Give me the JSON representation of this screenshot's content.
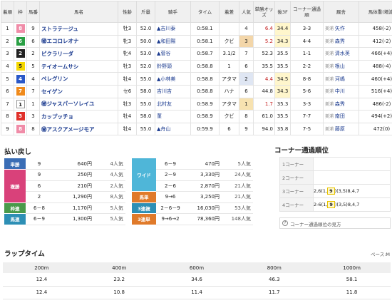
{
  "results": {
    "headers": [
      "着順",
      "枠",
      "馬番",
      "馬名",
      "性齢",
      "斤量",
      "騎手",
      "タイム",
      "着差",
      "人気",
      "単勝オッズ",
      "後3F",
      "コーナー通過順",
      "厩舎",
      "馬体重(増減)"
    ],
    "rows": [
      {
        "pos": "1",
        "waku": "8",
        "num": "9",
        "name": "ストラテージュ",
        "sex": "牡3",
        "wt": "52.0",
        "jockey": "▲吉川泰",
        "time": "0:58.1",
        "margin": "",
        "pop": "4",
        "odds": "6.4",
        "f3": "34.4",
        "corner": "3-3",
        "stable": "美浦 矢作",
        "bw": "458(-2)"
      },
      {
        "pos": "2",
        "waku": "6",
        "num": "6",
        "name": "㊙エコロレオナ",
        "sex": "牝3",
        "wt": "50.0",
        "jockey": "▲和田陽",
        "time": "0:58.1",
        "margin": "クビ",
        "pop": "3",
        "odds": "5.2",
        "f3": "34.3",
        "corner": "4-4",
        "stable": "美浦 森秀",
        "bw": "412(-2)"
      },
      {
        "pos": "3",
        "waku": "2",
        "num": "2",
        "name": "ピクラリーダ",
        "sex": "牝4",
        "wt": "53.0",
        "jockey": "▲菅谷",
        "time": "0:58.7",
        "margin": "3.1/2",
        "pop": "7",
        "odds": "52.3",
        "f3": "35.5",
        "corner": "1-1",
        "stable": "美浦 清水英",
        "bw": "466(+4)"
      },
      {
        "pos": "4",
        "waku": "5",
        "num": "5",
        "name": "テイオームサシ",
        "sex": "牡3",
        "wt": "52.0",
        "jockey": "鈴野頭",
        "time": "0:58.8",
        "margin": "1",
        "pop": "6",
        "odds": "35.5",
        "f3": "35.5",
        "corner": "2-2",
        "stable": "美浦 根山",
        "bw": "488(-4)"
      },
      {
        "pos": "5",
        "waku": "4",
        "num": "4",
        "name": "ペレグリン",
        "sex": "牡4",
        "wt": "55.0",
        "jockey": "▲小林美",
        "time": "0:58.8",
        "margin": "アタマ",
        "pop": "2",
        "odds": "4.4",
        "f3": "34.5",
        "corner": "8-8",
        "stable": "美浦 河嶋",
        "bw": "460(+4)"
      },
      {
        "pos": "6",
        "waku": "7",
        "num": "7",
        "name": "セイゲン",
        "sex": "セ6",
        "wt": "58.0",
        "jockey": "吉川吉",
        "time": "0:58.8",
        "margin": "ハナ",
        "pop": "6",
        "odds": "44.8",
        "f3": "34.3",
        "corner": "5-6",
        "stable": "美浦 中川",
        "bw": "516(+4)"
      },
      {
        "pos": "7",
        "waku": "1",
        "num": "1",
        "name": "㊙ジャスパーソレイユ",
        "sex": "牡3",
        "wt": "55.0",
        "jockey": "北村友",
        "time": "0:58.9",
        "margin": "アタマ",
        "pop": "1",
        "odds": "1.7",
        "f3": "35.3",
        "corner": "3-3",
        "stable": "美浦 森秀",
        "bw": "486(-2)"
      },
      {
        "pos": "8",
        "waku": "3",
        "num": "3",
        "name": "カップッチョ",
        "sex": "牡4",
        "wt": "58.0",
        "jockey": "菫",
        "time": "0:58.9",
        "margin": "クビ",
        "pop": "8",
        "odds": "61.0",
        "f3": "35.5",
        "corner": "7-7",
        "stable": "美浦 南田",
        "bw": "494(+2)"
      },
      {
        "pos": "9",
        "waku": "8",
        "num": "8",
        "name": "㊙アスクアメージモア",
        "sex": "牡4",
        "wt": "55.0",
        "jockey": "▲舟山",
        "time": "0:59.9",
        "margin": "6",
        "pop": "9",
        "odds": "94.0",
        "f3": "35.8",
        "corner": "7-5",
        "stable": "美浦 藤原",
        "bw": "472(0)"
      }
    ]
  },
  "payout": {
    "title": "払い戻し",
    "left": [
      {
        "label": "単勝",
        "num": "9",
        "amt": "640円",
        "pop": "4人気",
        "color": "#3a6db5",
        "span": 1
      },
      {
        "label": "複勝",
        "num": "9",
        "amt": "250円",
        "pop": "4人気",
        "color": "#d9417a",
        "span": 3
      },
      {
        "label": "",
        "num": "6",
        "amt": "210円",
        "pop": "2人気",
        "color": "",
        "span": 0
      },
      {
        "label": "",
        "num": "2",
        "amt": "1,290円",
        "pop": "8人気",
        "color": "",
        "span": 0
      },
      {
        "label": "枠連",
        "num": "6－8",
        "amt": "1,170円",
        "pop": "5人気",
        "color": "#4a9a4a",
        "span": 1
      },
      {
        "label": "馬連",
        "num": "6－9",
        "amt": "1,300円",
        "pop": "5人気",
        "color": "#2d8fb5",
        "span": 1
      }
    ],
    "right": [
      {
        "label": "ワイド",
        "num": "6－9",
        "amt": "470円",
        "pop": "5人気",
        "color": "#4fb6d8",
        "span": 3
      },
      {
        "label": "",
        "num": "2－9",
        "amt": "3,330円",
        "pop": "24人気",
        "color": "",
        "span": 0
      },
      {
        "label": "",
        "num": "2－6",
        "amt": "2,870円",
        "pop": "21人気",
        "color": "",
        "span": 0
      },
      {
        "label": "馬単",
        "num": "9→6",
        "amt": "3,250円",
        "pop": "21人気",
        "color": "#e07a2a",
        "span": 1
      },
      {
        "label": "3連複",
        "num": "2－6－9",
        "amt": "16,030円",
        "pop": "53人気",
        "color": "#2d8fb5",
        "span": 1
      },
      {
        "label": "3連単",
        "num": "9→6→2",
        "amt": "78,360円",
        "pop": "148人気",
        "color": "#e07a2a",
        "span": 1
      }
    ]
  },
  "corner": {
    "title": "コーナー通過順位",
    "rows": [
      {
        "label": "1コーナー",
        "pre": "",
        "box": "",
        "post": ""
      },
      {
        "label": "2コーナー",
        "pre": "",
        "box": "",
        "post": ""
      },
      {
        "label": "3コーナー",
        "pre": "2,6(1,",
        "box": "9",
        "post": ")(3,5)8,4,7"
      },
      {
        "label": "4コーナー",
        "pre": "2-6(1,",
        "box": "9",
        "post": ")(3,5)8,4,7"
      }
    ],
    "note": "コーナー通過順位の見方"
  },
  "lap": {
    "title": "ラップタイム",
    "pace": "ペース:M",
    "headers": [
      "200m",
      "400m",
      "600m",
      "800m",
      "1000m"
    ],
    "cumulative": [
      "12.4",
      "23.2",
      "34.6",
      "46.3",
      "58.1"
    ],
    "split": [
      "12.4",
      "10.8",
      "11.4",
      "11.7",
      "11.8"
    ]
  },
  "colors": {
    "waku": {
      "1": "#ffffff",
      "2": "#222222",
      "3": "#e0302a",
      "4": "#2a58c8",
      "5": "#f5d800",
      "6": "#2aa044",
      "7": "#f08a1a",
      "8": "#f08ca8"
    }
  }
}
